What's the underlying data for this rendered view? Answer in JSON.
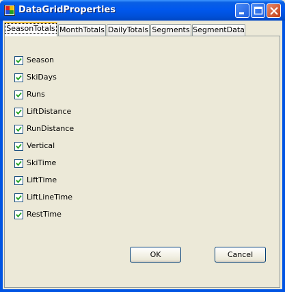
{
  "window": {
    "title": "DataGridProperties",
    "icon": "app-window-icon"
  },
  "titlebar_buttons": {
    "minimize": "minimize-icon",
    "maximize": "maximize-icon",
    "close": "close-icon"
  },
  "tabs": [
    {
      "label": "SeasonTotals",
      "active": true
    },
    {
      "label": "MonthTotals",
      "active": false
    },
    {
      "label": "DailyTotals",
      "active": false
    },
    {
      "label": "Segments",
      "active": false
    },
    {
      "label": "SegmentData",
      "active": false
    }
  ],
  "checkboxes": [
    {
      "label": "Season",
      "checked": true
    },
    {
      "label": "SkiDays",
      "checked": true
    },
    {
      "label": "Runs",
      "checked": true
    },
    {
      "label": "LiftDistance",
      "checked": true
    },
    {
      "label": "RunDistance",
      "checked": true
    },
    {
      "label": "Vertical",
      "checked": true
    },
    {
      "label": "SkiTime",
      "checked": true
    },
    {
      "label": "LiftTime",
      "checked": true
    },
    {
      "label": "LiftLineTime",
      "checked": true
    },
    {
      "label": "RestTime",
      "checked": true
    }
  ],
  "buttons": {
    "ok": "OK",
    "cancel": "Cancel"
  },
  "colors": {
    "titlebar": "#0054e3",
    "face": "#ece9d8",
    "active_tab_accent": "#ffc83c"
  }
}
